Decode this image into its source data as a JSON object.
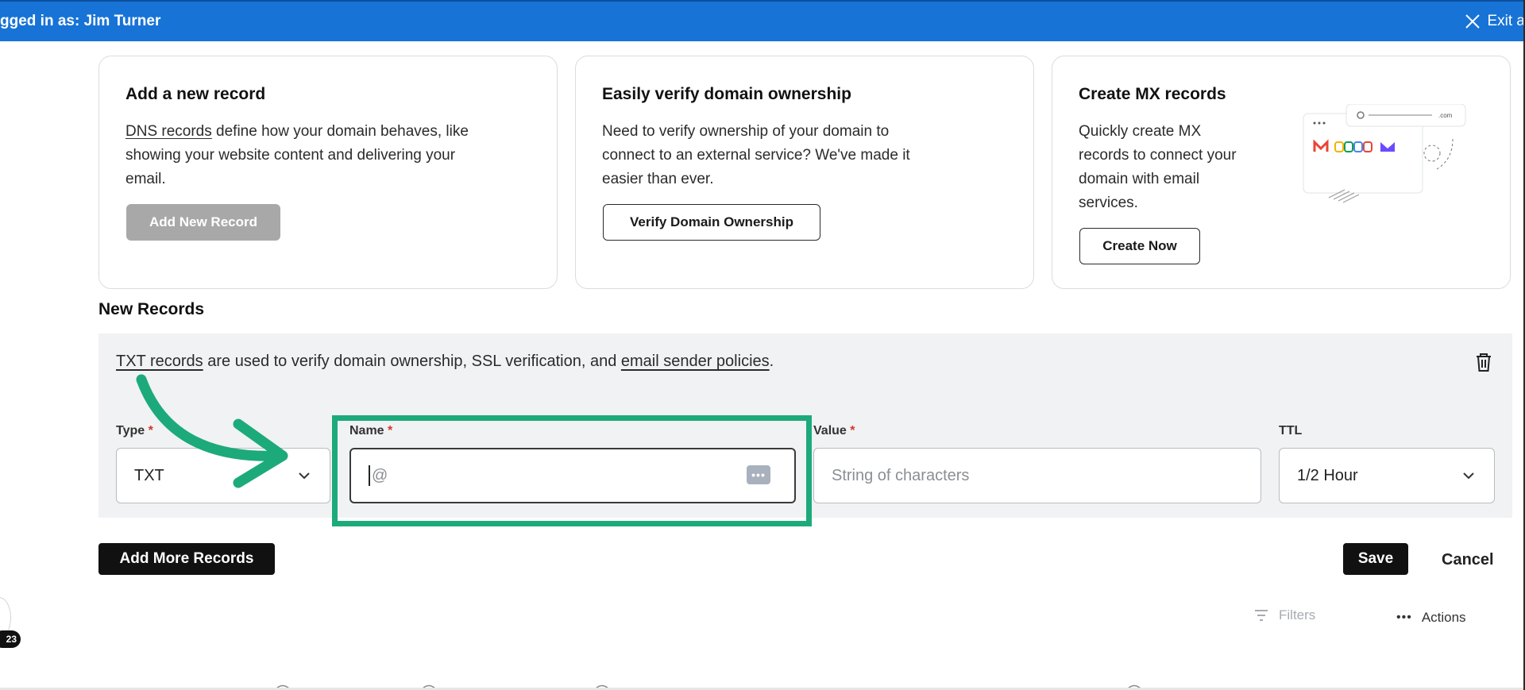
{
  "banner": {
    "logged_in": "gged in as: Jim Turner",
    "exit_label": "Exit a"
  },
  "cards": {
    "add_record": {
      "title": "Add a new record",
      "desc_link": "DNS records",
      "desc_line1_rest": " define how your domain behaves, like",
      "desc_line2": "showing your website content and delivering your",
      "desc_line3": "email.",
      "button": "Add New Record"
    },
    "verify": {
      "title": "Easily verify domain ownership",
      "desc_line1": "Need to verify ownership of your domain to",
      "desc_line2": "connect to an external service? We've made it",
      "desc_line3": "easier than ever.",
      "button": "Verify Domain Ownership"
    },
    "mx": {
      "title": "Create MX records",
      "desc_line1": "Quickly create MX",
      "desc_line2": "records to connect your",
      "desc_line3": "domain with email",
      "desc_line4": "services.",
      "button": "Create Now",
      "art_url_text": ".com"
    }
  },
  "new_records": {
    "section_title": "New Records",
    "info_link1": "TXT records",
    "info_middle": " are used to verify domain ownership, SSL verification, and ",
    "info_link2": "email sender policies",
    "info_end": ".",
    "fields": {
      "type_label": "Type",
      "type_value": "TXT",
      "name_label": "Name",
      "name_value": "@",
      "value_label": "Value",
      "value_placeholder": "String of characters",
      "ttl_label": "TTL",
      "ttl_value": "1/2 Hour",
      "required_mark": "*"
    }
  },
  "actions": {
    "add_more": "Add More Records",
    "save": "Save",
    "cancel": "Cancel",
    "filters": "Filters",
    "actions_label": "Actions",
    "dots": "•••"
  },
  "left_badge": "23",
  "colors": {
    "banner": "#1773d6",
    "highlight": "#1daa7b",
    "panel": "#f1f2f3"
  }
}
